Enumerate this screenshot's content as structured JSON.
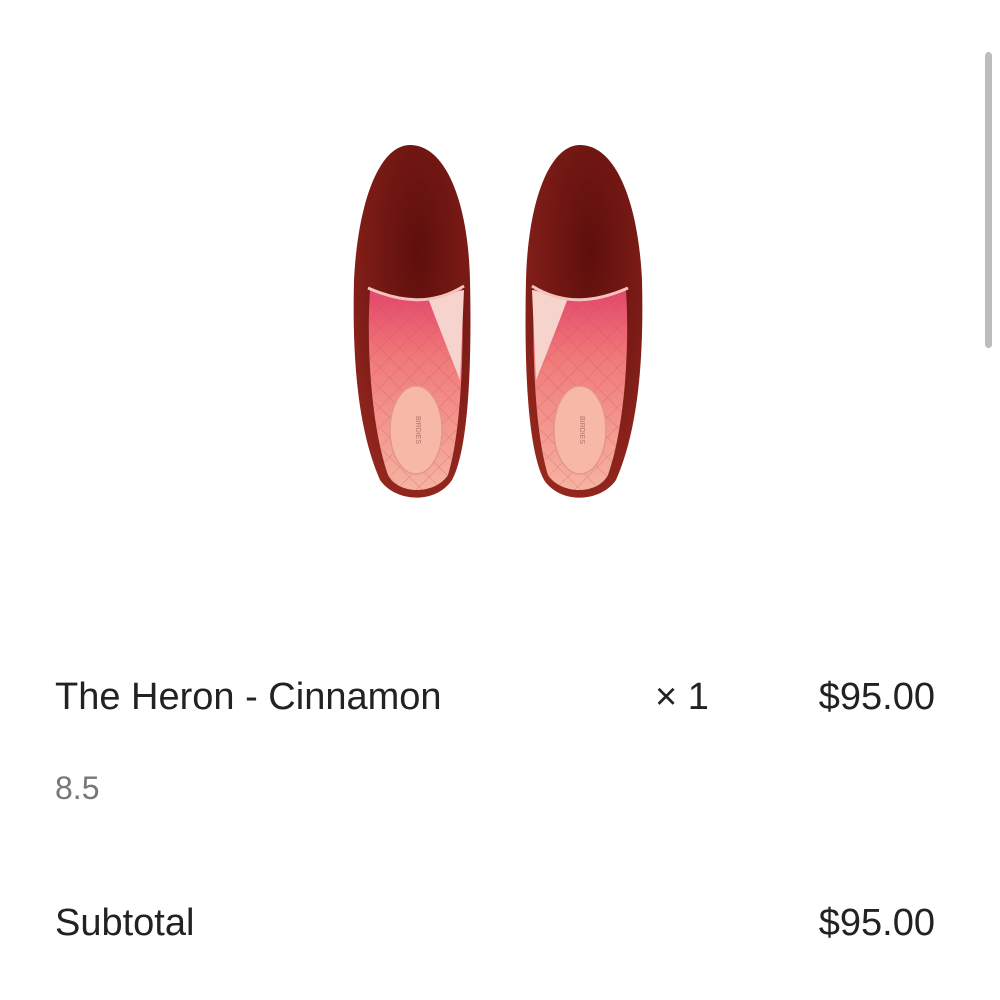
{
  "product": {
    "image_label": "product image: two cinnamon velvet loafers",
    "insole_brand": "BIRDIES",
    "name": "The Heron - Cinnamon",
    "quantity": "× 1",
    "price": "$95.00",
    "variant": "8.5"
  },
  "summary": {
    "subtotal_label": "Subtotal",
    "subtotal_value": "$95.00"
  },
  "colors": {
    "velvet": "#7a1a16",
    "insole": "#f1a79a",
    "lining": "#e07c78"
  }
}
